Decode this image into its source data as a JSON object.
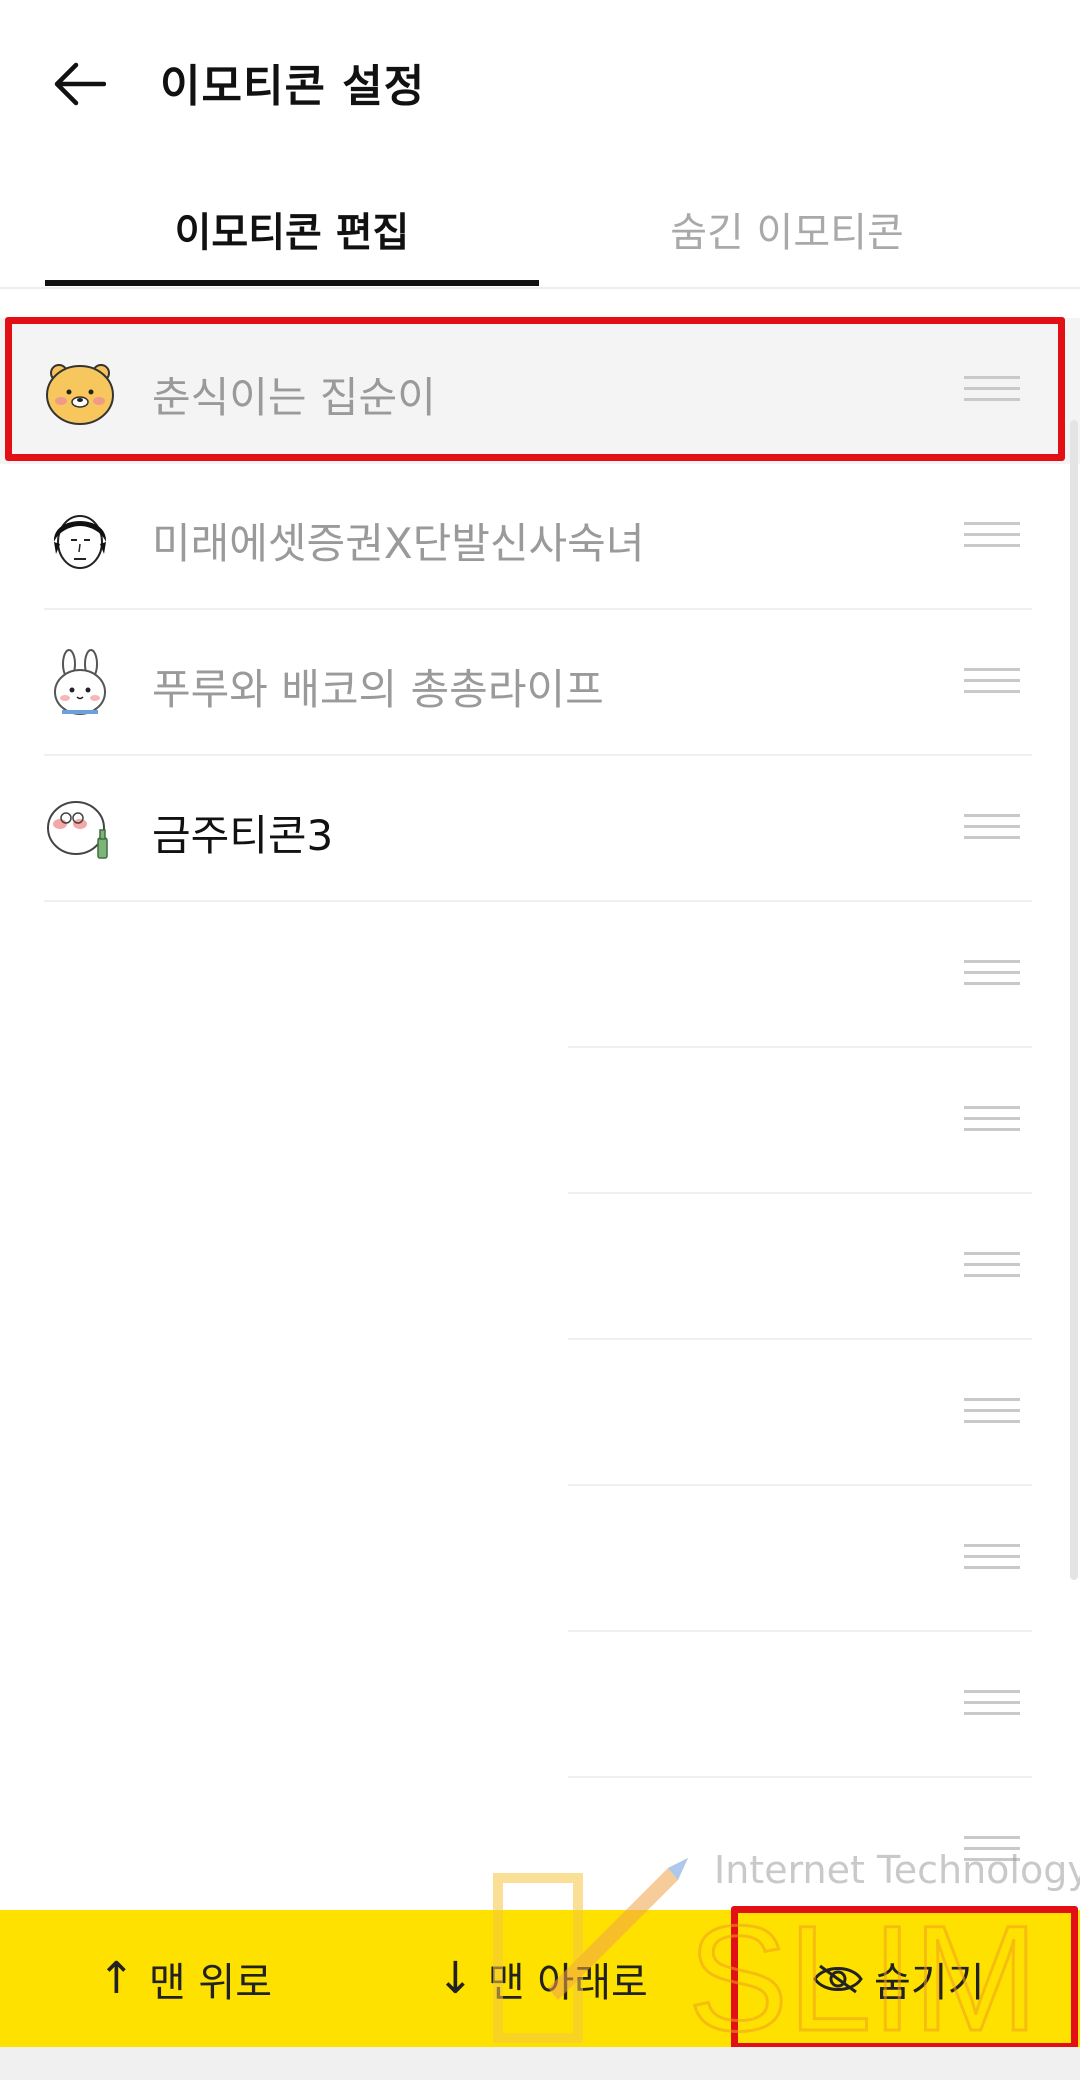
{
  "header": {
    "title": "이모티콘 설정"
  },
  "tabs": [
    {
      "label": "이모티콘 편집",
      "active": true
    },
    {
      "label": "숨긴 이모티콘",
      "active": false
    }
  ],
  "emoticons": [
    {
      "name": "춘식이는 집순이",
      "icon": "chunsik-face-icon",
      "selected": true
    },
    {
      "name": "미래에셋증권X단발신사숙녀",
      "icon": "bob-hair-face-icon"
    },
    {
      "name": "푸루와 배코의 총총라이프",
      "icon": "rabbit-face-icon"
    },
    {
      "name": "금주티콘3",
      "icon": "bottle-character-icon"
    }
  ],
  "watermark": {
    "text": "Internet Technology",
    "brand": "SLIM"
  },
  "bottom_bar": {
    "top": "맨 위로",
    "bottom": "맨 아래로",
    "hide": "숨기기"
  },
  "colors": {
    "accent": "#ffe100",
    "highlight": "#e21014"
  }
}
